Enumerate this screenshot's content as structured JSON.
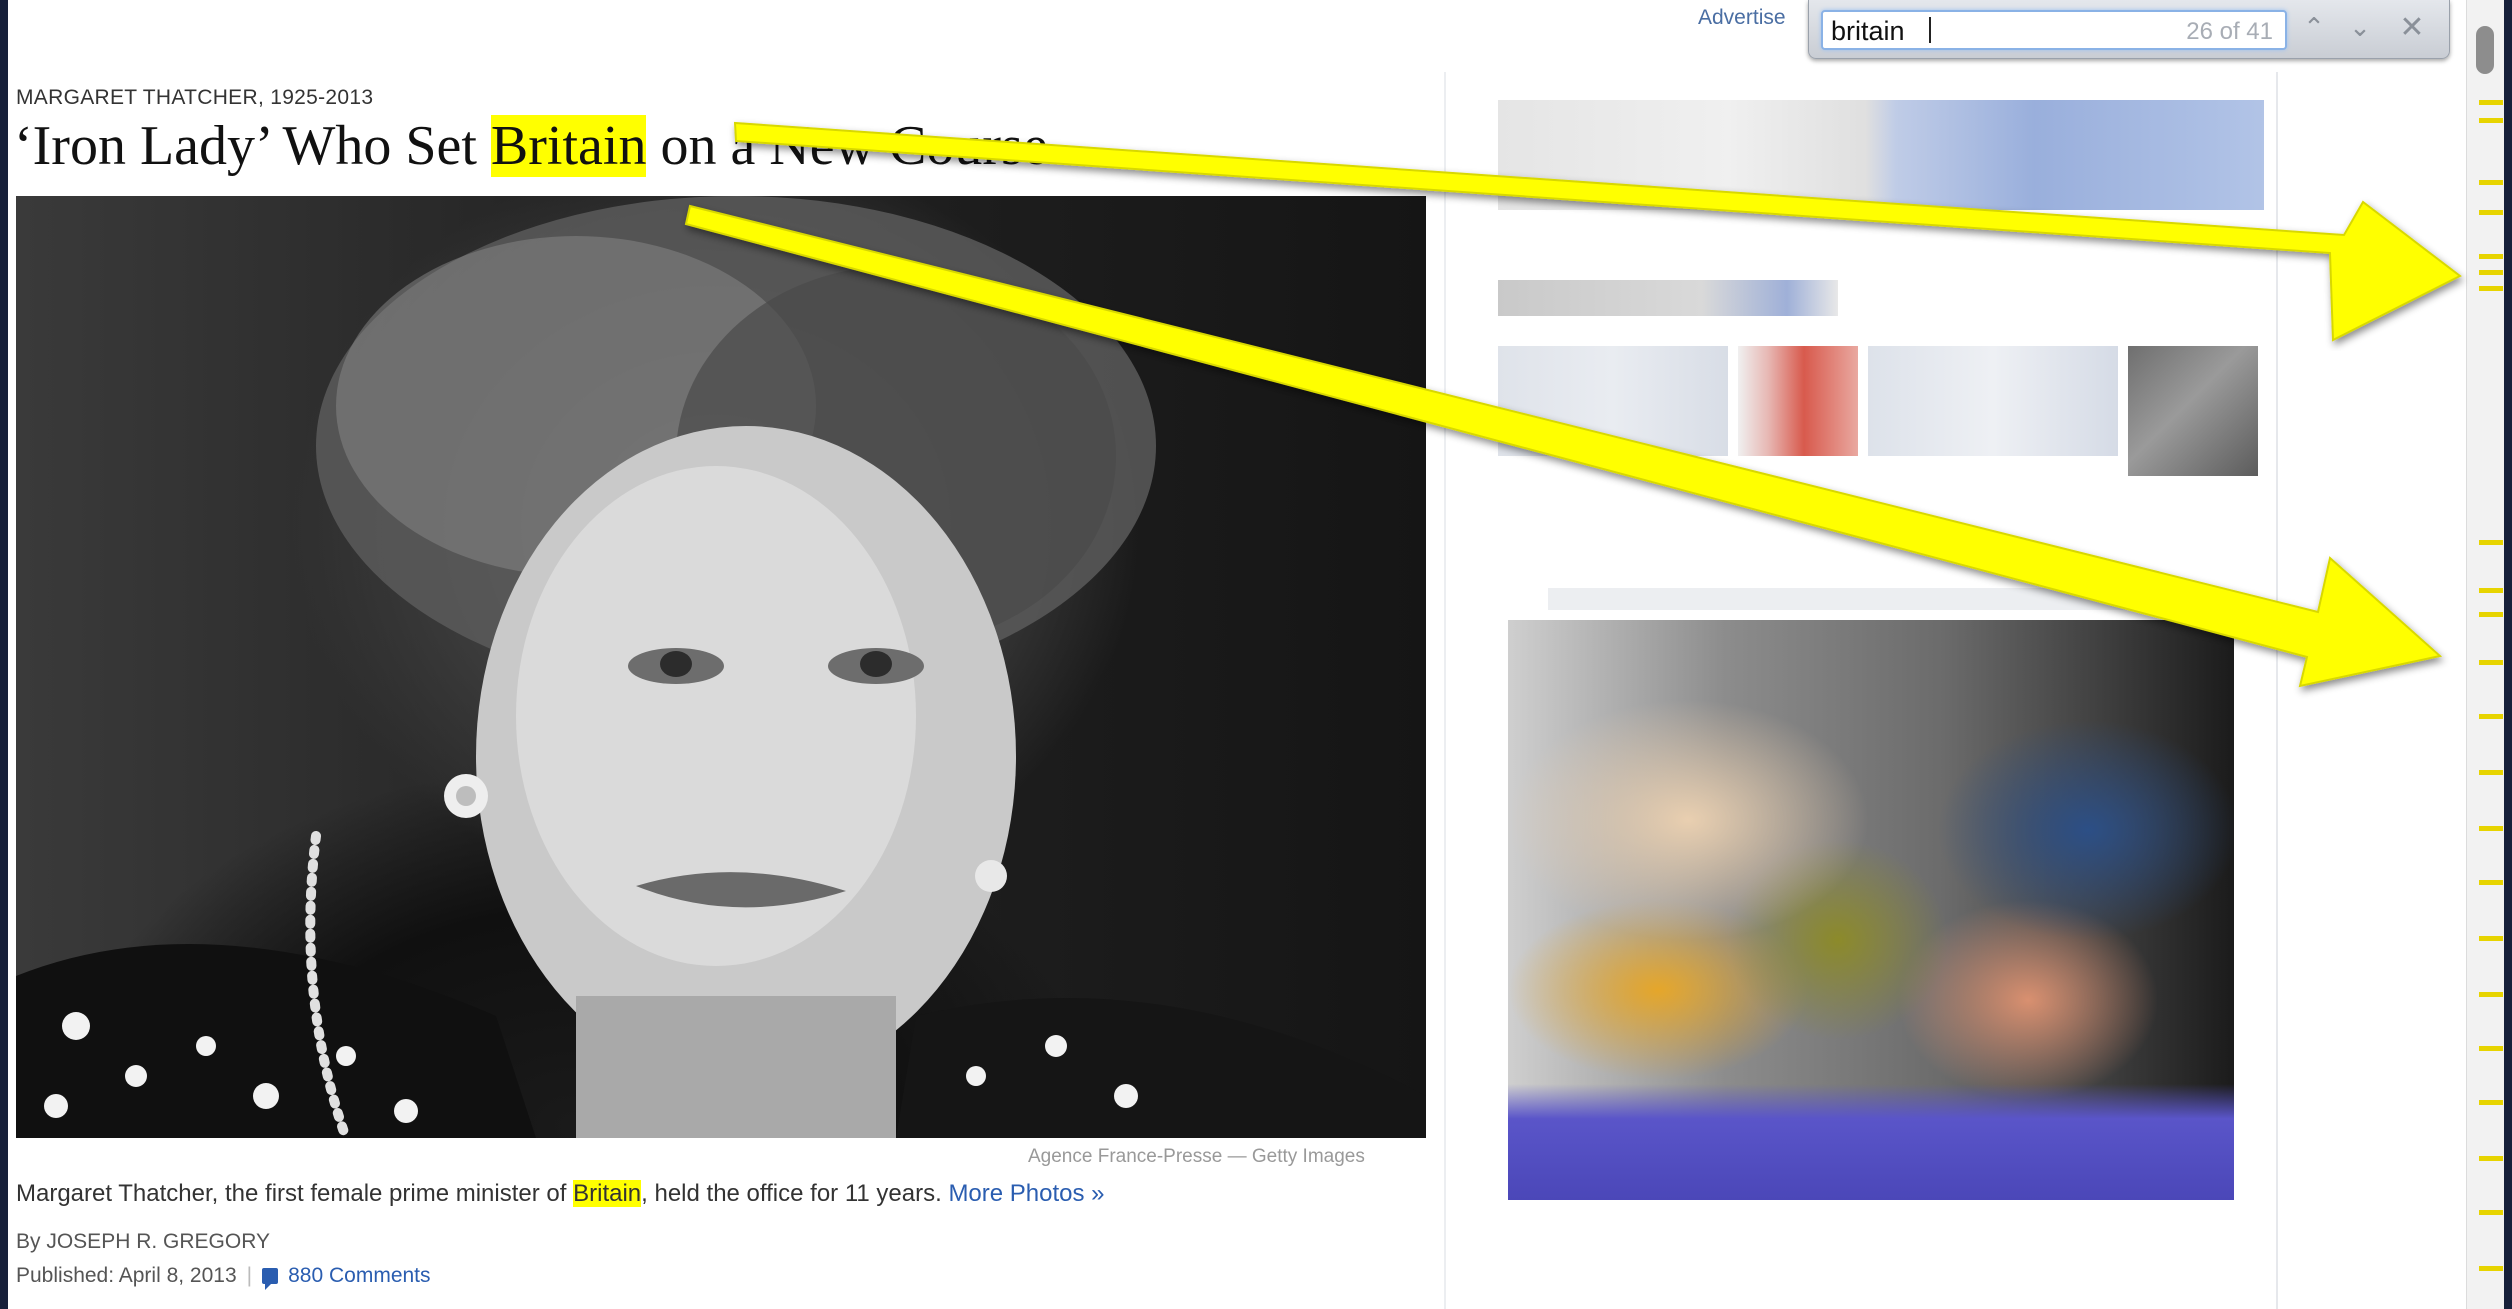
{
  "topbar": {
    "advertise_label": "Advertise"
  },
  "find": {
    "query": "britain",
    "match_count": "26 of 41",
    "prev_icon": "chevron-up-icon",
    "next_icon": "chevron-down-icon",
    "close_icon": "close-icon",
    "highlight_color": "#ffff00"
  },
  "article": {
    "kicker": "MARGARET THATCHER, 1925-2013",
    "headline_before": "‘Iron Lady’ Who Set ",
    "headline_match": "Britain",
    "headline_after": " on a New Course",
    "photo_credit": "Agence France-Presse — Getty Images",
    "caption_before": "Margaret Thatcher, the first female prime minister of ",
    "caption_match": "Britain",
    "caption_after": ", held the office for 11 years. ",
    "caption_link": "More Photos »",
    "byline": "By JOSEPH R. GREGORY",
    "published": "Published: April 8, 2013",
    "comments": "880 Comments"
  },
  "scrollbar": {
    "match_marker_color": "#e7d400",
    "scroll_position": 0.02
  },
  "annotation": {
    "arrow_color": "#ffff00"
  }
}
